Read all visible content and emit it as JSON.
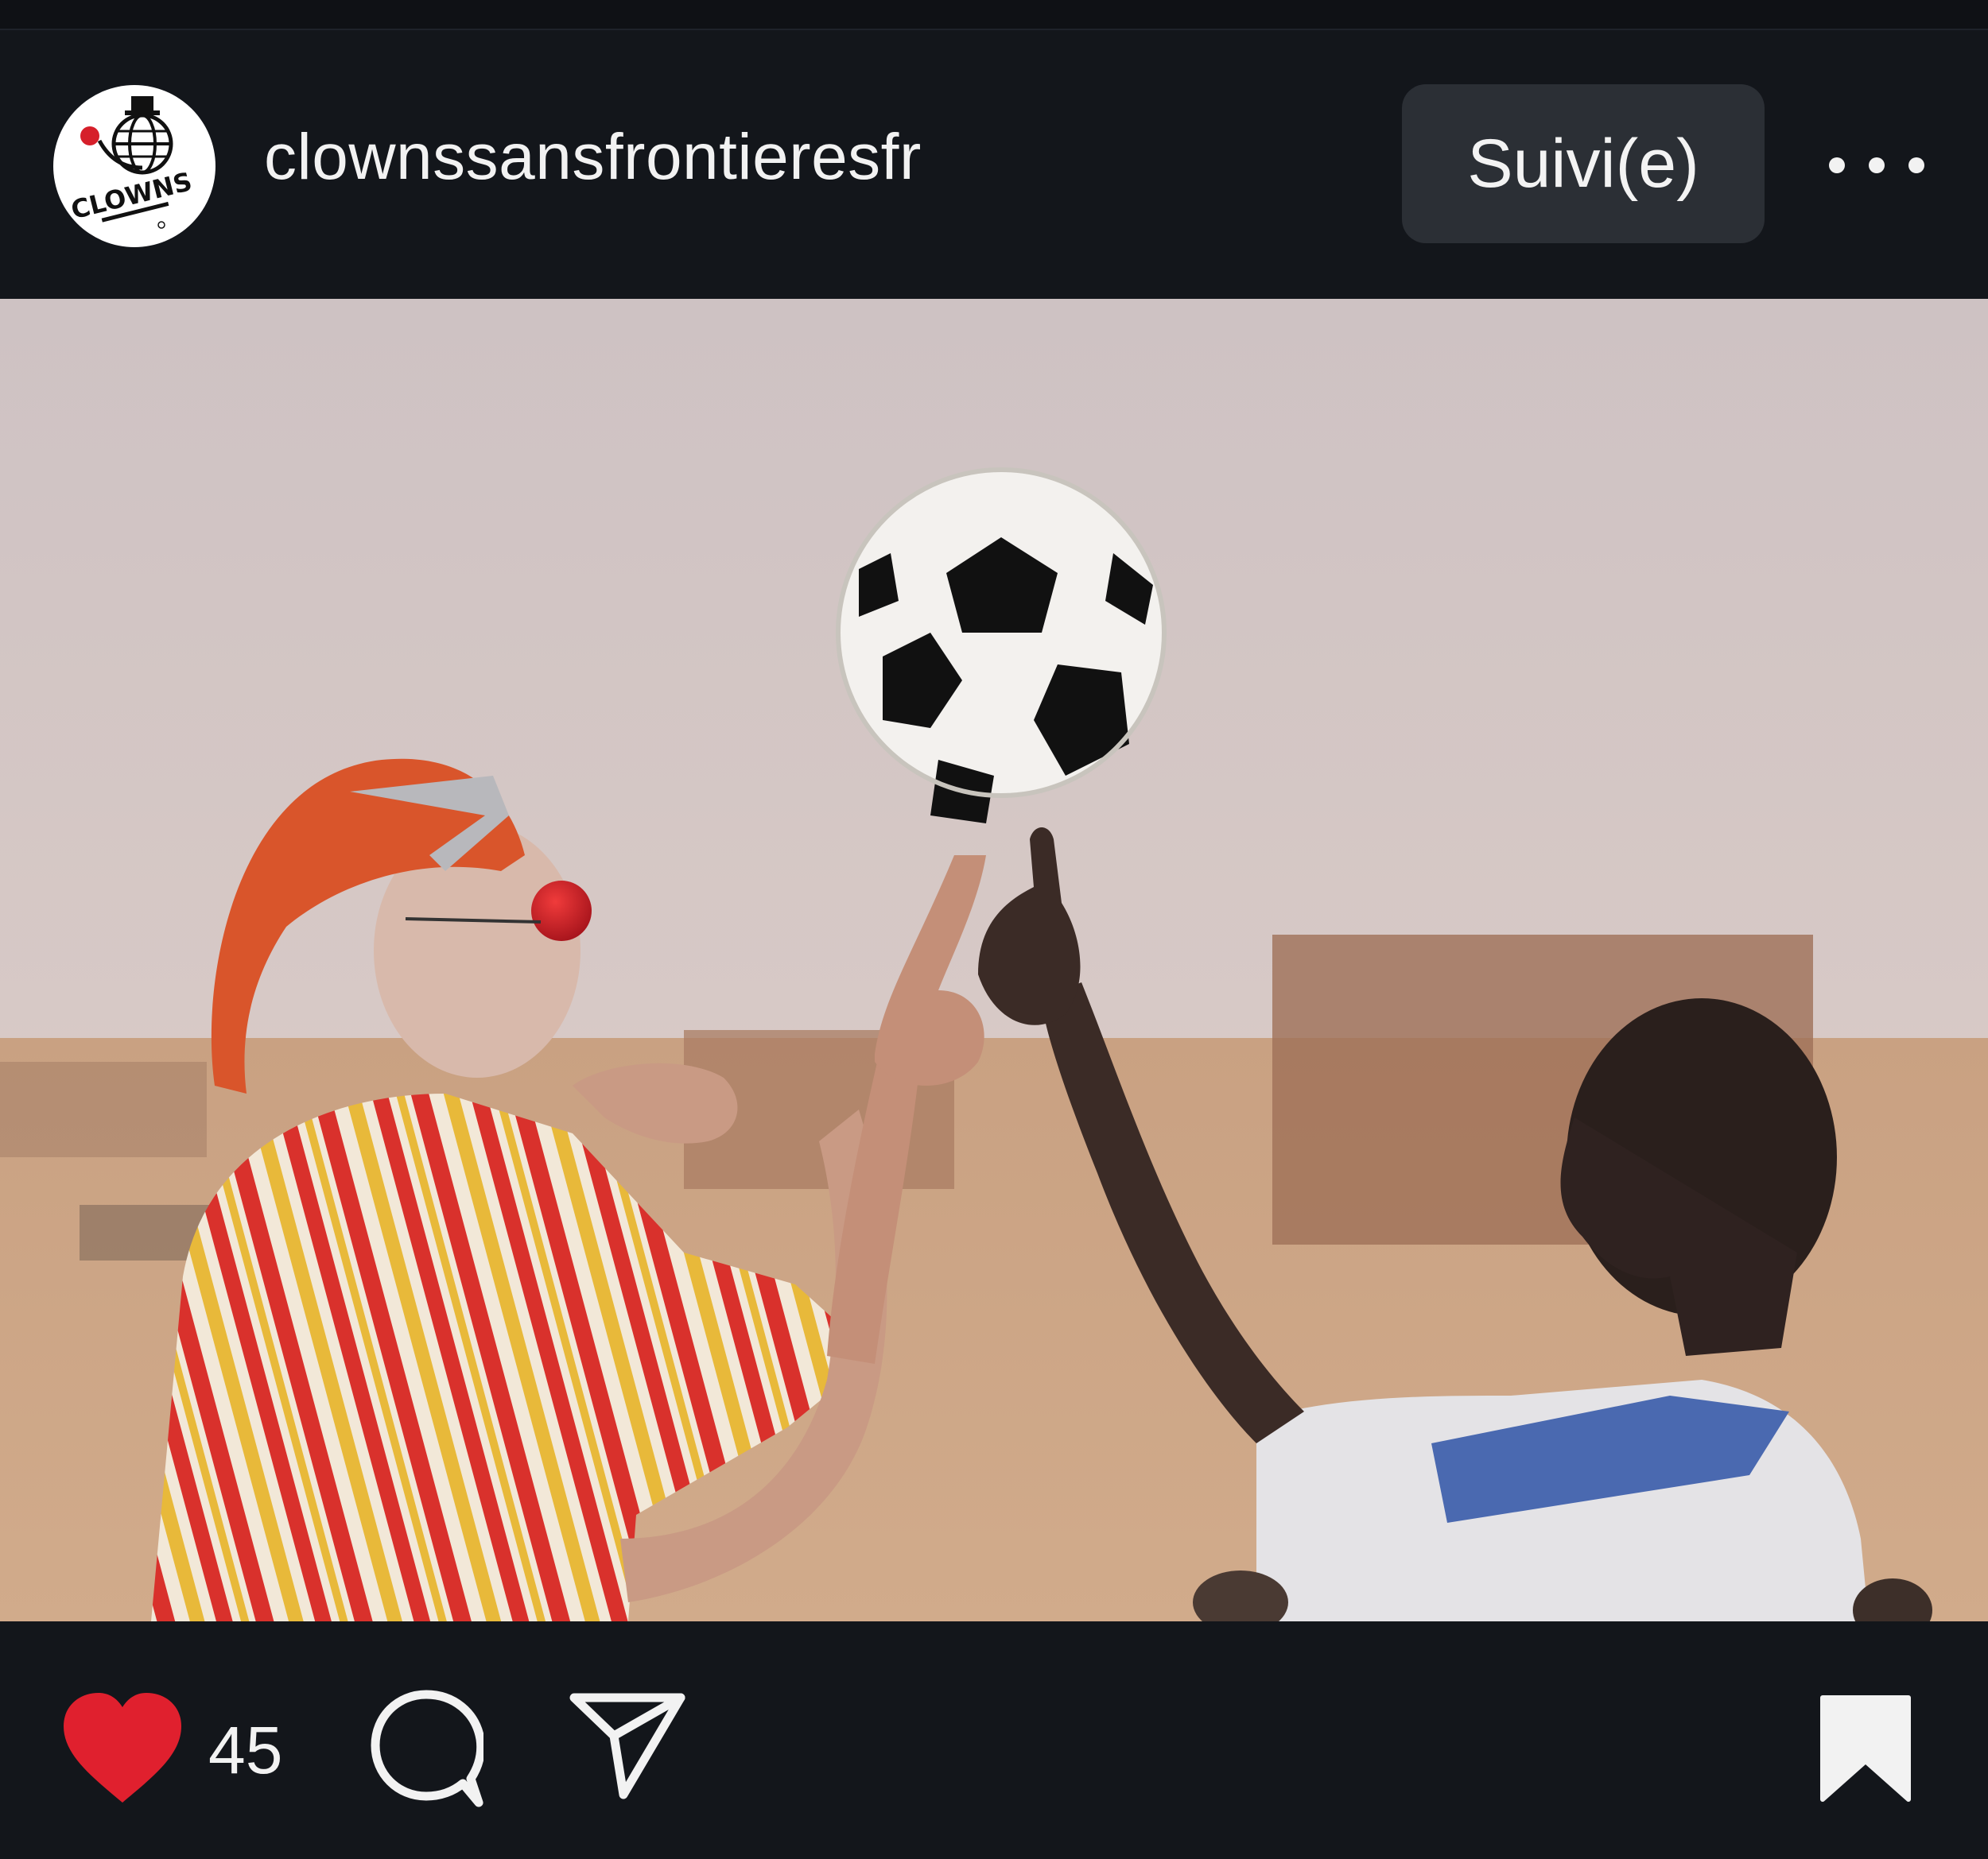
{
  "post": {
    "account": {
      "username": "clownssansfrontieresfr",
      "avatar_icon": "clowns-sans-frontieres-logo",
      "avatar_logo_text": "CLOWNS"
    },
    "follow_button_label": "Suivi(e)",
    "more_icon": "more-horizontal-icon",
    "photo_icons": [
      "clown",
      "boy",
      "soccer-ball"
    ],
    "actions": {
      "liked": true,
      "like_color": "#e0202e",
      "like_count": "45",
      "like_icon": "heart-filled-icon",
      "comment_icon": "comment-icon",
      "share_icon": "send-icon",
      "save_icon": "bookmark-filled-icon"
    }
  },
  "colors": {
    "background": "#13161b",
    "button": "#2b2f35",
    "text": "#f2f2f2"
  }
}
